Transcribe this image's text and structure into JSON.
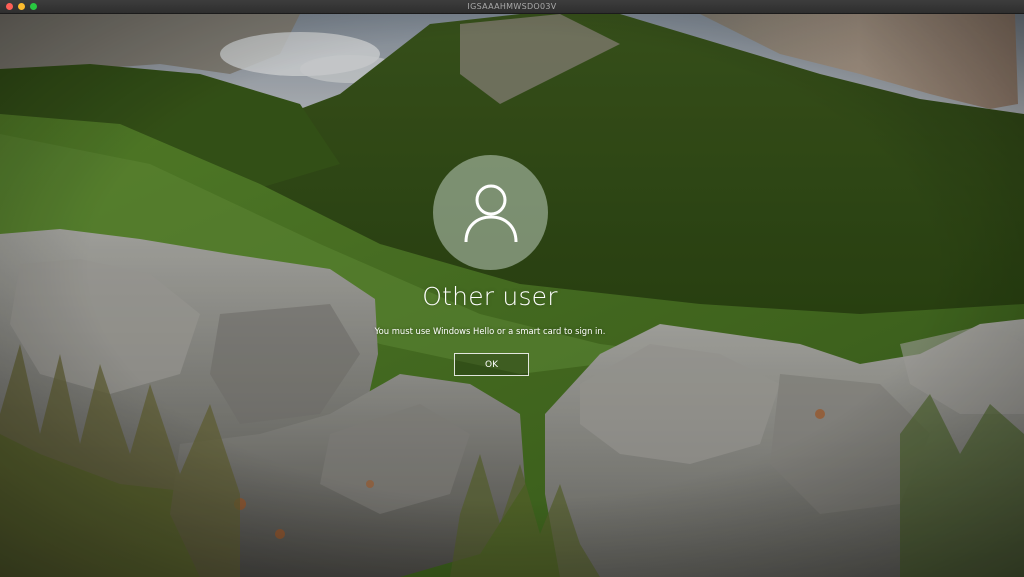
{
  "window": {
    "title": "IGSAAAHMWSDO03V"
  },
  "sign_in": {
    "avatar_icon": "user-icon",
    "username": "Other user",
    "message": "You must use Windows Hello or a smart card to sign in.",
    "ok_label": "OK"
  },
  "colors": {
    "window_close": "#fe5f57",
    "window_minimize": "#febc2e",
    "window_maximize": "#28c840"
  }
}
